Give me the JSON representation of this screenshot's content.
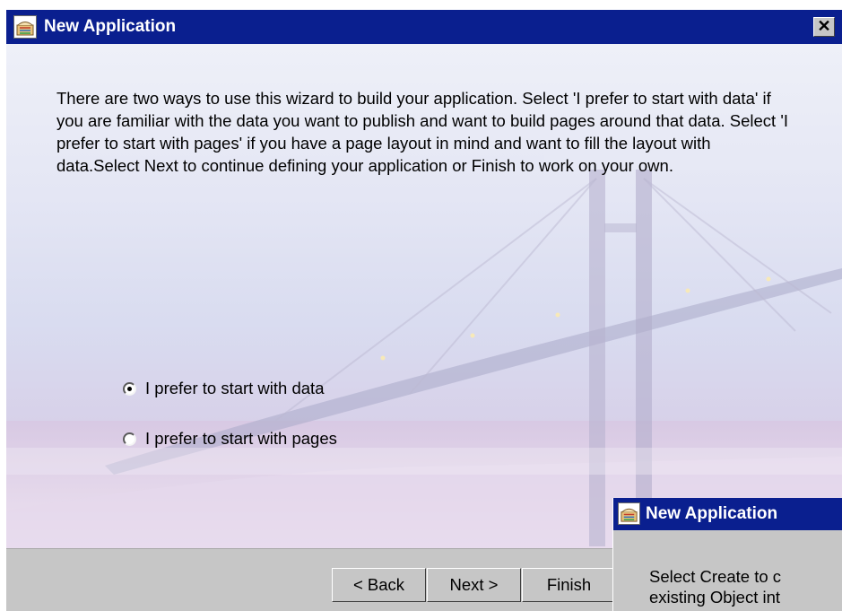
{
  "window": {
    "title": "New Application",
    "close_glyph": "✕",
    "intro_text": "There are two ways to use this wizard to build your application. Select 'I prefer to start with data' if you are familiar with the data you want to publish and want to build pages around that data. Select 'I prefer to start with pages' if you have a page layout in mind and want to fill the layout with data.Select Next to continue defining your application or Finish to work on your own.",
    "options": [
      {
        "label": "I prefer to start with data",
        "checked": true
      },
      {
        "label": "I prefer to start with pages",
        "checked": false
      }
    ],
    "buttons": {
      "back": "< Back",
      "next": "Next >",
      "finish": "Finish"
    }
  },
  "overlay_dialog": {
    "title": "New Application",
    "body_line1": "Select Create to c",
    "body_line2": "existing Object int"
  },
  "colors": {
    "titlebar": "#0a1f8f",
    "chrome": "#c6c6c6"
  }
}
